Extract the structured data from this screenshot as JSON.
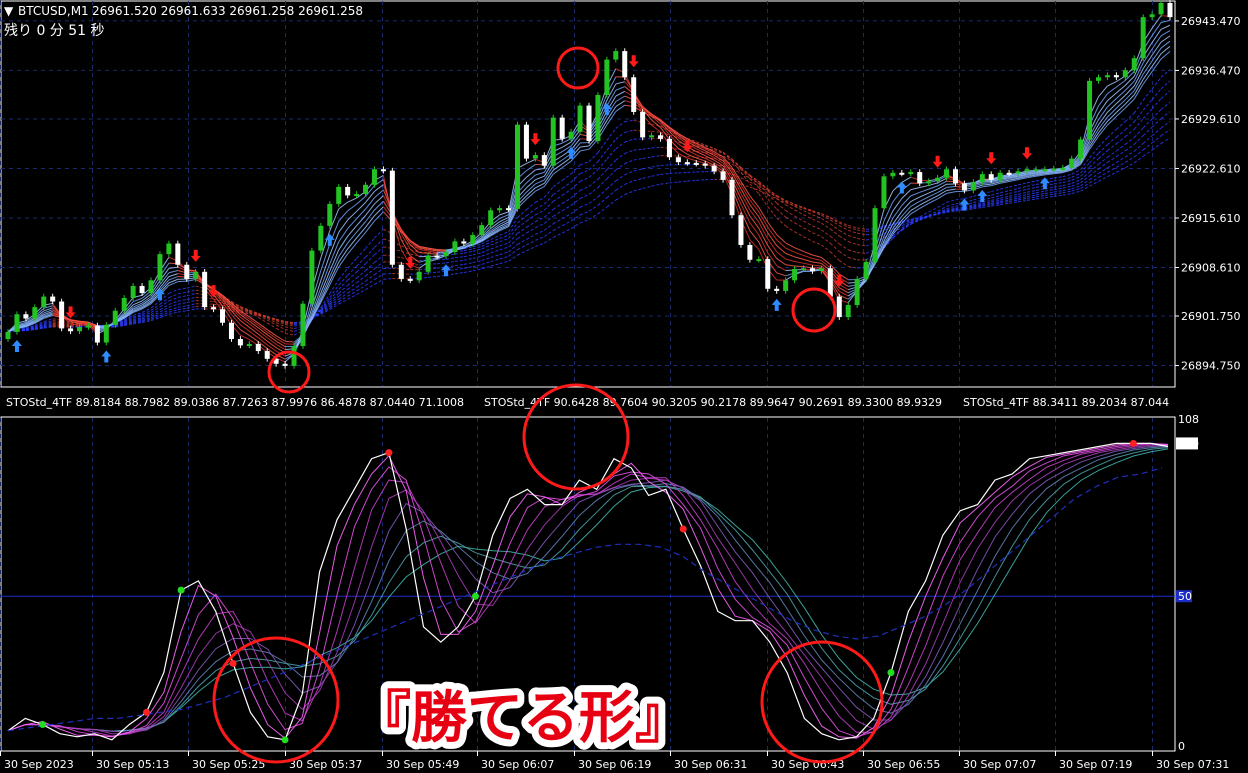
{
  "chart_data": [
    {
      "type": "candlestick",
      "header": {
        "symbol": "BTCUSD,M1",
        "ohlc": "26961.520 26961.633 26961.258 26961.258",
        "countdown": "残り 0 分 51 秒"
      },
      "y_ticks": [
        "26943.470",
        "26936.470",
        "26929.610",
        "26922.610",
        "26915.610",
        "26908.610",
        "26901.750",
        "26894.750"
      ],
      "ylim": [
        26892.0,
        26946.0
      ],
      "close": [
        26899.5,
        26902.0,
        26901.4,
        26903.0,
        26904.5,
        26903.8,
        26900.0,
        26899.6,
        26900.2,
        26900.4,
        26898.0,
        26900.5,
        26902.5,
        26904.3,
        26906.0,
        26905.0,
        26906.8,
        26910.5,
        26912.0,
        26909.0,
        26907.0,
        26908.0,
        26903.0,
        26902.7,
        26900.8,
        26898.5,
        26897.6,
        26897.8,
        26896.8,
        26895.7,
        26895.0,
        26894.7,
        26897.5,
        26903.5,
        26911.0,
        26914.5,
        26917.6,
        26920.0,
        26918.8,
        26919.0,
        26920.3,
        26922.5,
        26922.3,
        26909.0,
        26907.0,
        26906.8,
        26908.0,
        26910.3,
        26910.2,
        26910.8,
        26912.3,
        26912.0,
        26913.2,
        26914.6,
        26916.7,
        26917.0,
        26916.9,
        26928.8,
        26924.0,
        26924.5,
        26923.0,
        26929.8,
        26926.8,
        26927.8,
        26931.5,
        26926.5,
        26933.0,
        26938.0,
        26939.2,
        26935.5,
        26930.6,
        26927.0,
        26927.3,
        26926.8,
        26924.2,
        26923.5,
        26923.4,
        26923.3,
        26923.0,
        26922.2,
        26921.0,
        26916.0,
        26911.8,
        26909.7,
        26909.8,
        26905.6,
        26905.3,
        26906.8,
        26908.4,
        26908.5,
        26908.1,
        26908.5,
        26904.5,
        26901.6,
        26903.3,
        26907.0,
        26909.4,
        26917.0,
        26921.5,
        26922.0,
        26921.9,
        26922.1,
        26920.5,
        26920.8,
        26921.3,
        26922.5,
        26920.5,
        26919.5,
        26920.7,
        26921.8,
        26921.0,
        26922.0,
        26921.9,
        26922.2,
        26922.5,
        26922.5,
        26922.5,
        26922.6,
        26922.7,
        26924.0,
        26926.7,
        26935.0,
        26935.5,
        26935.8,
        26935.5,
        26936.5,
        26938.2,
        26944.0,
        26944.4,
        26946.0,
        26944.0
      ],
      "buy_arrows": [
        1,
        11,
        17,
        36,
        49,
        63,
        67,
        86,
        100,
        107,
        109,
        116
      ],
      "sell_arrows": [
        7,
        21,
        23,
        45,
        59,
        70,
        76,
        93,
        104,
        110,
        114
      ],
      "x_ticks": [
        "30 Sep 2023",
        "30 Sep 05:13",
        "30 Sep 05:25",
        "30 Sep 05:37",
        "30 Sep 05:49",
        "30 Sep 06:07",
        "30 Sep 06:19",
        "30 Sep 06:31",
        "30 Sep 06:43",
        "30 Sep 06:55",
        "30 Sep 07:07",
        "30 Sep 07:19",
        "30 Sep 07:31"
      ]
    },
    {
      "type": "line",
      "indicator_header": [
        "STOStd_4TF 89.8184 88.7982 89.0386 87.7263 87.9976 86.4878 87.0440 71.1008",
        "STOStd_4TF 90.6428 89.7604 90.3205 90.2178 89.9647 90.2691 89.3300 89.9329",
        "STOStd_4TF 88.3411 89.2034 87.044"
      ],
      "ylim": [
        0,
        108
      ],
      "y_ticks": [
        "108",
        "100",
        "50",
        "0"
      ],
      "level_line": 50,
      "main_line": [
        6,
        10,
        8,
        5,
        4,
        5,
        3,
        8,
        12,
        25,
        52,
        55,
        45,
        28,
        12,
        4,
        3,
        18,
        58,
        75,
        85,
        95,
        97,
        72,
        40,
        35,
        40,
        50,
        70,
        82,
        85,
        80,
        80,
        88,
        85,
        95,
        92,
        83,
        85,
        72,
        60,
        45,
        42,
        42,
        35,
        25,
        10,
        5,
        3,
        4,
        10,
        25,
        45,
        55,
        70,
        78,
        80,
        88,
        90,
        95,
        96,
        97,
        98,
        99,
        100,
        100,
        100,
        99
      ],
      "slow_line": [
        6,
        7,
        8,
        9,
        10,
        10,
        11,
        12,
        13,
        15,
        17,
        20,
        23,
        26,
        29,
        32,
        35,
        38,
        41,
        44,
        47,
        50,
        53,
        56,
        59,
        62,
        64,
        66,
        67,
        67,
        66,
        63,
        58,
        54,
        50,
        46,
        42,
        39,
        37,
        36,
        37,
        40,
        43,
        47,
        52,
        58,
        64,
        70,
        76,
        82,
        86,
        89,
        90,
        92
      ]
    }
  ],
  "banner": "『勝てる形』"
}
